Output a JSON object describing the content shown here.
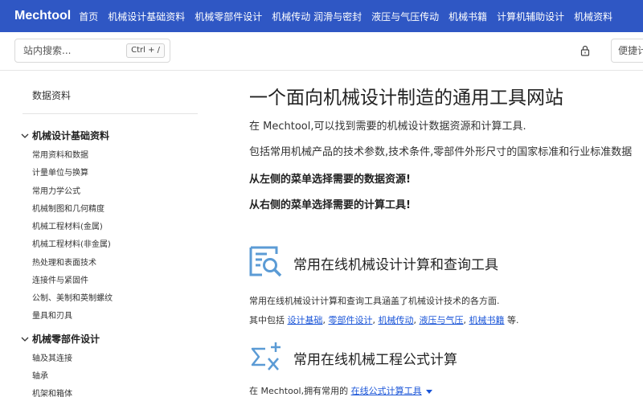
{
  "navbar": {
    "brand": "Mechtool",
    "items": [
      "首页",
      "机械设计基础资料",
      "机械零部件设计",
      "机械传动 润滑与密封",
      "液压与气压传动",
      "机械书籍",
      "计算机辅助设计",
      "机械资料"
    ]
  },
  "search": {
    "placeholder": "站内搜索...",
    "shortcut": "Ctrl + /",
    "quick_placeholder": "便捷计算"
  },
  "sidebar": {
    "heading": "数据资料",
    "cat1": {
      "label": "机械设计基础资料",
      "items": [
        "常用资料和数据",
        "计量单位与换算",
        "常用力学公式",
        "机械制图和几何精度",
        "机械工程材料(金属)",
        "机械工程材料(非金属)",
        "热处理和表面技术",
        "连接件与紧固件",
        "公制、美制和英制螺纹",
        "量具和刃具"
      ]
    },
    "cat2": {
      "label": "机械零部件设计",
      "items": [
        "轴及其连接",
        "轴承",
        "机架和箱体"
      ]
    }
  },
  "main": {
    "title": "一个面向机械设计制造的通用工具网站",
    "intro1": "在 Mechtool,可以找到需要的机械设计数据资源和计算工具.",
    "intro2": "包括常用机械产品的技术参数,技术条件,零部件外形尺寸的国家标准和行业标准数据",
    "bold1": "从左侧的菜单选择需要的数据资源!",
    "bold2": "从右侧的菜单选择需要的计算工具!",
    "section1": {
      "title": "常用在线机械设计计算和查询工具",
      "desc": "常用在线机械设计计算和查询工具涵盖了机械设计技术的各方面.",
      "prefix": "其中包括",
      "links": [
        "设计基础",
        "零部件设计",
        "机械传动",
        "液压与气压",
        "机械书籍"
      ],
      "sep": ",",
      "suffix": "等."
    },
    "section2": {
      "title": "常用在线机械工程公式计算",
      "desc_prefix": "在 Mechtool,拥有常用的",
      "link": "在线公式计算工具"
    }
  },
  "colors": {
    "navbar": "#2f57c4",
    "link": "#1a55d8",
    "icon": "#5b9bd5"
  }
}
